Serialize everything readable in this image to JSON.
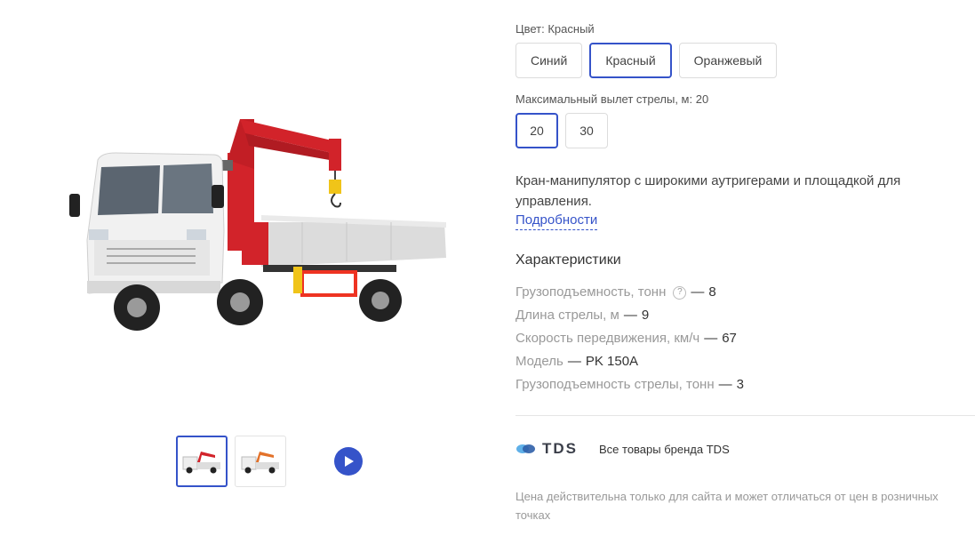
{
  "gallery": {
    "thumbnails": [
      {
        "label": "Кран-манипулятор, белая кабина, красная стрела",
        "active": true
      },
      {
        "label": "Кран-манипулятор, оранжевая стрела",
        "active": false
      }
    ],
    "play_icon": "play-icon"
  },
  "color": {
    "label": "Цвет: Красный",
    "options": [
      "Синий",
      "Красный",
      "Оранжевый"
    ],
    "selected": "Красный"
  },
  "boom": {
    "label": "Максимальный вылет стрелы, м: 20",
    "options": [
      "20",
      "30"
    ],
    "selected": "20"
  },
  "description": "Кран-манипулятор с широкими аутригерами и площадкой для управления.",
  "details_link": "Подробности",
  "specs": {
    "title": "Характеристики",
    "items": [
      {
        "key": "Грузоподъемность, тонн",
        "value": "8",
        "help": "?"
      },
      {
        "key": "Длина стрелы, м",
        "value": "9"
      },
      {
        "key": "Скорость передвижения, км/ч",
        "value": "67"
      },
      {
        "key": "Модель",
        "value": "PK 150A"
      },
      {
        "key": "Грузоподъемность стрелы, тонн",
        "value": "3"
      }
    ],
    "separator": "—"
  },
  "brand": {
    "name": "TDS",
    "link_text": "Все товары бренда TDS",
    "logo_colors": [
      "#5fb0e8",
      "#2f5fa8"
    ]
  },
  "price_note": "Цена действительна только для сайта и может отличаться от цен в розничных точках",
  "colors": {
    "accent": "#3553c9",
    "truck_cab": "#f1f1f1",
    "crane_red": "#d2232a",
    "crane_orange": "#e3722a"
  }
}
